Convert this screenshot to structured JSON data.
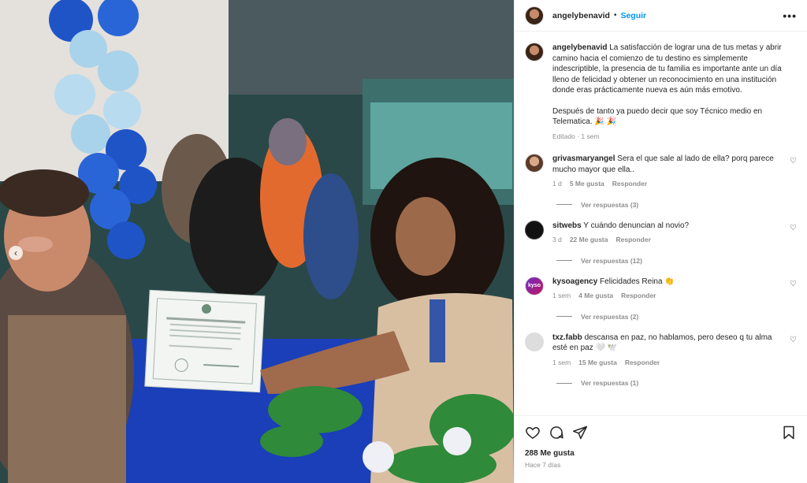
{
  "post": {
    "author": "angelybenavid",
    "separator": "•",
    "follow_label": "Seguir",
    "more_label": "•••",
    "caption_p1": "La satisfacción de lograr una de tus metas y abrir camino hacia el comienzo de tu destino es simplemente indescriptible, la presencia de tu familia es importante ante un día lleno de felicidad y obtener un reconocimiento en una institución donde eras prácticamente nueva es aún más emotivo.",
    "caption_p2": "Después de tanto ya puedo decir que soy Técnico medio en Telematica. 🎉 🎉",
    "caption_meta": "Editado · 1 sem",
    "prev_label": "‹"
  },
  "comments": [
    {
      "user": "grivasmaryangel",
      "text": "Sera el que sale al lado de ella? porq parece mucho mayor que ella..",
      "time": "1 d",
      "likes": "5 Me gusta",
      "reply": "Responder",
      "replies": "Ver respuestas (3)",
      "avatar": "grivasmaryangel-avatar"
    },
    {
      "user": "sitwebs",
      "text": "Y cuándo denuncian al novio?",
      "time": "3 d",
      "likes": "22 Me gusta",
      "reply": "Responder",
      "replies": "Ver respuestas (12)",
      "avatar": "sitwebs-avatar"
    },
    {
      "user": "kysoagency",
      "text": "Felicidades Reina 👏",
      "time": "1 sem",
      "likes": "4 Me gusta",
      "reply": "Responder",
      "replies": "Ver respuestas (2)",
      "avatar": "kysoagency-avatar",
      "avatar_text": "kyso"
    },
    {
      "user": "txz.fabb",
      "text": "descansa en paz, no hablamos, pero deseo q tu alma esté en paz 🤍 🕊️",
      "time": "1 sem",
      "likes": "15 Me gusta",
      "reply": "Responder",
      "replies": "Ver respuestas (1)",
      "avatar": "txz-fabb-avatar"
    }
  ],
  "footer": {
    "likes": "288 Me gusta",
    "ago": "Hace 7 días"
  },
  "colors": {
    "accent": "#0095f6",
    "muted": "#8e8e8e",
    "text": "#262626"
  }
}
